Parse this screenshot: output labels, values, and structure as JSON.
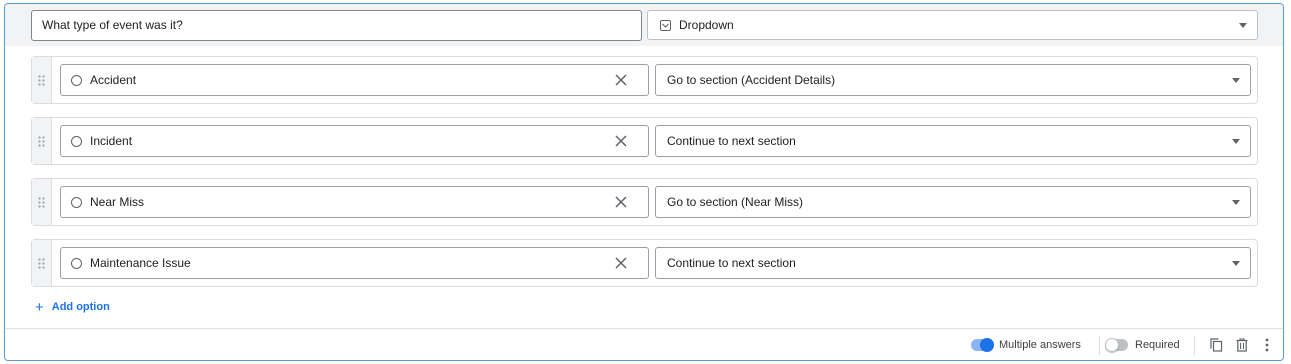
{
  "question": {
    "text": "What type of event was it?",
    "type_label": "Dropdown",
    "type_icon": "dropdown-icon"
  },
  "options": [
    {
      "label": "Accident",
      "goto": "Go to section (Accident Details)"
    },
    {
      "label": "Incident",
      "goto": "Continue to next section"
    },
    {
      "label": "Near Miss",
      "goto": "Go to section (Near Miss)"
    },
    {
      "label": "Maintenance Issue",
      "goto": "Continue to next section"
    }
  ],
  "add_option_label": "Add option",
  "footer": {
    "multiple_answers_label": "Multiple answers",
    "multiple_answers_on": true,
    "required_label": "Required",
    "required_on": false
  },
  "colors": {
    "accent": "#1a73e8",
    "card_border": "#5f9bd1",
    "header_bg": "#f1f3f4"
  }
}
